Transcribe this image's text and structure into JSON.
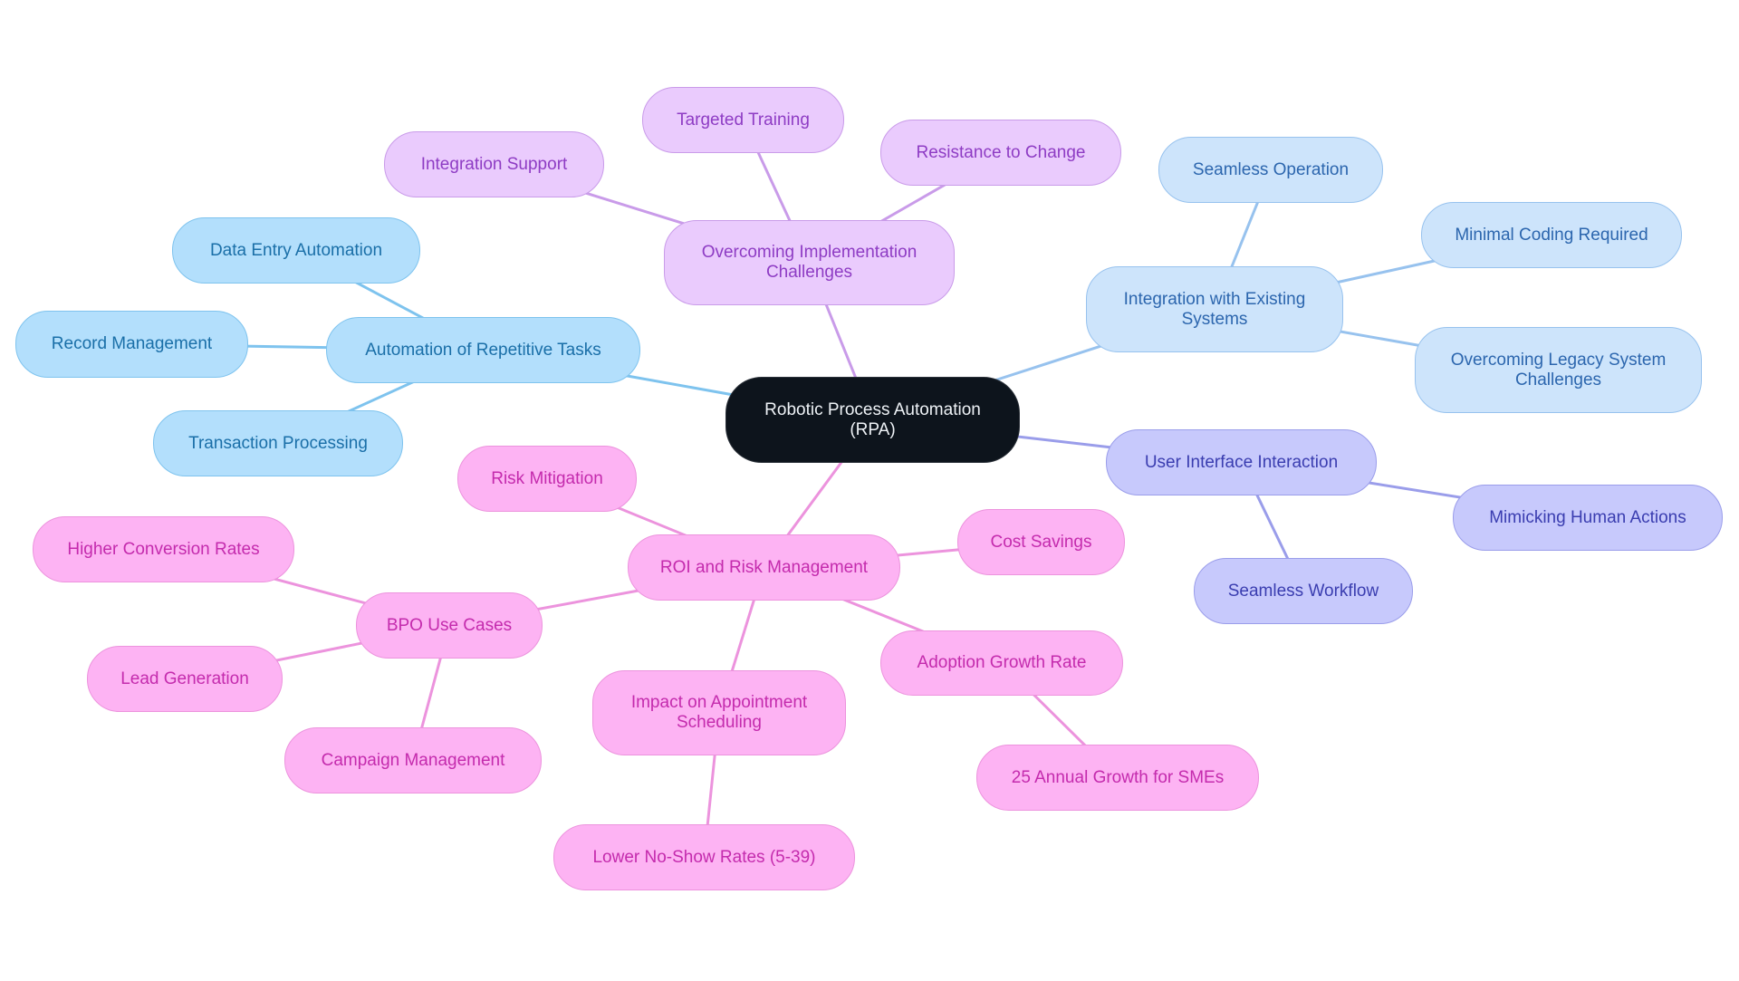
{
  "diagram": {
    "type": "mindmap",
    "root": {
      "id": "root",
      "label_line1": "Robotic Process Automation",
      "label_line2": "(RPA)",
      "theme": "root"
    },
    "branches": [
      {
        "id": "auto",
        "label": "Automation of Repetitive Tasks",
        "theme": "blue",
        "children": [
          {
            "id": "dataEntry",
            "label": "Data Entry Automation"
          },
          {
            "id": "record",
            "label": "Record Management"
          },
          {
            "id": "transaction",
            "label": "Transaction Processing"
          }
        ]
      },
      {
        "id": "overcoming",
        "label_line1": "Overcoming Implementation",
        "label_line2": "Challenges",
        "theme": "purple",
        "children": [
          {
            "id": "intSupport",
            "label": "Integration Support"
          },
          {
            "id": "targeted",
            "label": "Targeted Training"
          },
          {
            "id": "resistance",
            "label": "Resistance to Change"
          }
        ]
      },
      {
        "id": "integration",
        "label_line1": "Integration with Existing",
        "label_line2": "Systems",
        "theme": "lightblue",
        "children": [
          {
            "id": "seamlessOp",
            "label": "Seamless Operation"
          },
          {
            "id": "minimal",
            "label": "Minimal Coding Required"
          },
          {
            "id": "legacy",
            "label_line1": "Overcoming Legacy System",
            "label_line2": "Challenges"
          }
        ]
      },
      {
        "id": "ui",
        "label": "User Interface Interaction",
        "theme": "lavender",
        "children": [
          {
            "id": "mimicking",
            "label": "Mimicking Human Actions"
          },
          {
            "id": "workflow",
            "label": "Seamless Workflow"
          }
        ]
      },
      {
        "id": "roi",
        "label": "ROI and Risk Management",
        "theme": "pink",
        "children": [
          {
            "id": "risk",
            "label": "Risk Mitigation"
          },
          {
            "id": "cost",
            "label": "Cost Savings"
          },
          {
            "id": "bpo",
            "label": "BPO Use Cases",
            "children": [
              {
                "id": "higher",
                "label": "Higher Conversion Rates"
              },
              {
                "id": "lead",
                "label": "Lead Generation"
              },
              {
                "id": "campaign",
                "label": "Campaign Management"
              }
            ]
          },
          {
            "id": "impact",
            "label_line1": "Impact on Appointment",
            "label_line2": "Scheduling",
            "children": [
              {
                "id": "lower",
                "label": "Lower No-Show Rates (5-39)"
              }
            ]
          },
          {
            "id": "adoption",
            "label": "Adoption Growth Rate",
            "children": [
              {
                "id": "annual",
                "label": "25 Annual Growth for SMEs"
              }
            ]
          }
        ]
      }
    ],
    "colors": {
      "root_fill": "#0d141c",
      "blue_fill": "#b3dffc",
      "blue_edge": "#7ec3ee",
      "purple_fill": "#eacbfd",
      "purple_edge": "#c99be9",
      "lightblue_fill": "#cde4fb",
      "lightblue_edge": "#97c2ee",
      "lavender_fill": "#c7c9fc",
      "lavender_edge": "#9a9dea",
      "pink_fill": "#fdb3f3",
      "pink_edge": "#ec93dd"
    }
  }
}
